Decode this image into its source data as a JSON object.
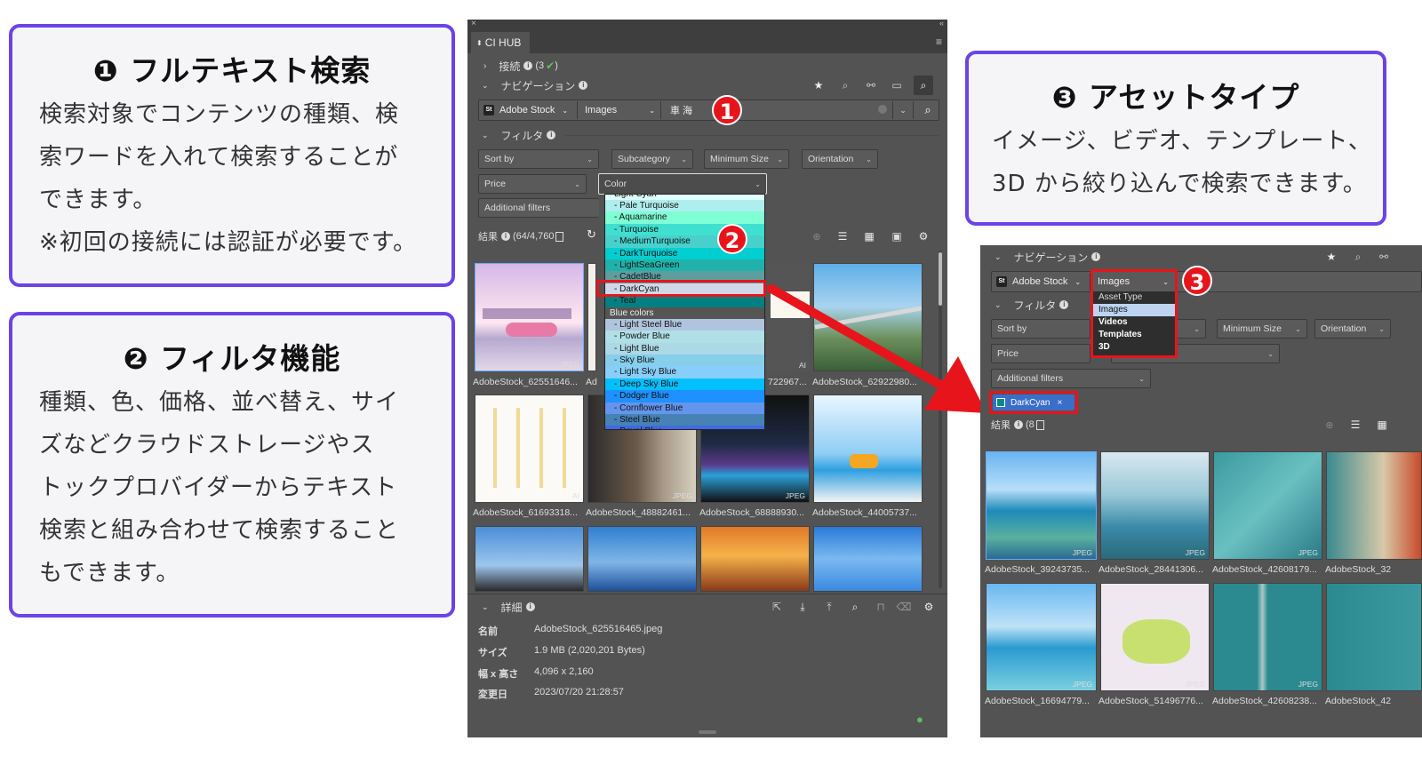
{
  "callouts": {
    "c1": {
      "title": "❶ フルテキスト検索",
      "lines": [
        "検索対象でコンテンツの種類、検",
        "索ワードを入れて検索することが",
        "できます。",
        "※初回の接続には認証が必要です。"
      ]
    },
    "c2": {
      "title": "❷ フィルタ機能",
      "lines": [
        "種類、色、価格、並べ替え、サイ",
        "ズなどクラウドストレージやス",
        "トックプロバイダーからテキスト",
        "検索と組み合わせて検索すること",
        "もできます。"
      ]
    },
    "c3": {
      "title": "❸ アセットタイプ",
      "lines": [
        "イメージ、ビデオ、テンプレート、",
        "3D から絞り込んで検索できます。"
      ]
    }
  },
  "badges": {
    "b1": "1",
    "b2": "2",
    "b3": "3"
  },
  "panel": {
    "tab_title": "CI HUB",
    "connection_label": "接続",
    "connection_count": "(3",
    "navigation_label": "ナビゲーション",
    "provider": "Adobe Stock",
    "provider_icon": "St",
    "asset_type": "Images",
    "search_query": "車 海",
    "filter_label": "フィルタ",
    "filters": {
      "sort_by": "Sort by",
      "subcategory": "Subcategory",
      "min_size": "Minimum Size",
      "orientation": "Orientation",
      "price": "Price",
      "color": "Color",
      "additional": "Additional filters"
    },
    "results_label": "結果",
    "results_count": "(64/4,760",
    "color_options": [
      {
        "label": "Light Cyan",
        "color": "#e0ffff"
      },
      {
        "label": "- Pale Turquoise",
        "color": "#afeeee"
      },
      {
        "label": "- Aquamarine",
        "color": "#7fffd4"
      },
      {
        "label": "- Turquoise",
        "color": "#40e0d0"
      },
      {
        "label": "- MediumTurquoise",
        "color": "#48d1cc"
      },
      {
        "label": "- DarkTurquoise",
        "color": "#00ced1"
      },
      {
        "label": "- LightSeaGreen",
        "color": "#20b2aa"
      },
      {
        "label": "- CadetBlue",
        "color": "#5f9ea0"
      },
      {
        "label": "- DarkCyan",
        "color": "#cfd8e6"
      },
      {
        "label": "- Teal",
        "color": "#008080"
      }
    ],
    "blue_group": "Blue colors",
    "blue_options": [
      {
        "label": "- Light Steel Blue",
        "color": "#b0c4de"
      },
      {
        "label": "- Powder Blue",
        "color": "#b0e0e6"
      },
      {
        "label": "- Light Blue",
        "color": "#add8e6"
      },
      {
        "label": "- Sky Blue",
        "color": "#87ceeb"
      },
      {
        "label": "- Light Sky Blue",
        "color": "#87cefa"
      },
      {
        "label": "- Deep Sky Blue",
        "color": "#00bfff"
      },
      {
        "label": "- Dodger Blue",
        "color": "#1e90ff"
      },
      {
        "label": "- Cornflower Blue",
        "color": "#6495ed"
      },
      {
        "label": "- Steel Blue",
        "color": "#4682b4"
      },
      {
        "label": "- Royal Blue",
        "color": "#4169e1"
      }
    ],
    "thumbs": [
      {
        "cap": "AdobeStock_62551646...",
        "tag": "JPEG"
      },
      {
        "cap": "Ad",
        "tag": ""
      },
      {
        "cap": "722967...",
        "tag": "AI"
      },
      {
        "cap": "AdobeStock_62922980...",
        "tag": ""
      },
      {
        "cap": "AdobeStock_61693318...",
        "tag": "AI"
      },
      {
        "cap": "AdobeStock_48882461...",
        "tag": "JPEG"
      },
      {
        "cap": "AdobeStock_68888930...",
        "tag": "JPEG"
      },
      {
        "cap": "AdobeStock_44005737...",
        "tag": "AI"
      }
    ],
    "detail_label": "詳細",
    "details": [
      {
        "k": "名前",
        "v": "AdobeStock_625516465.jpeg"
      },
      {
        "k": "サイズ",
        "v": "1.9 MB (2,020,201 Bytes)"
      },
      {
        "k": "幅 x 高さ",
        "v": "4,096 x 2,160"
      },
      {
        "k": "変更日",
        "v": "2023/07/20 21:28:57"
      }
    ]
  },
  "panel2": {
    "navigation_label": "ナビゲーション",
    "provider": "Adobe Stock",
    "provider_icon": "St",
    "asset_type": "Images",
    "type_options": [
      "Asset Type",
      "Images",
      "Videos",
      "Templates",
      "3D"
    ],
    "filter_label": "フィルタ",
    "sort_by": "Sort by",
    "subcat_partial": "y",
    "min_size": "Minimum Size",
    "orientation": "Orientation",
    "price": "Price",
    "additional": "Additional filters",
    "chip": "DarkCyan",
    "results_label": "結果",
    "results_count": "(8",
    "thumbs": [
      {
        "cap": "AdobeStock_39243735...",
        "tag": "JPEG"
      },
      {
        "cap": "AdobeStock_28441306...",
        "tag": "JPEG"
      },
      {
        "cap": "AdobeStock_42608179...",
        "tag": "JPEG"
      },
      {
        "cap": "AdobeStock_32",
        "tag": ""
      },
      {
        "cap": "AdobeStock_16694779...",
        "tag": "JPEG"
      },
      {
        "cap": "AdobeStock_51496776...",
        "tag": "JPEG"
      },
      {
        "cap": "AdobeStock_42608238...",
        "tag": "JPEG"
      },
      {
        "cap": "AdobeStock_42",
        "tag": ""
      }
    ]
  }
}
